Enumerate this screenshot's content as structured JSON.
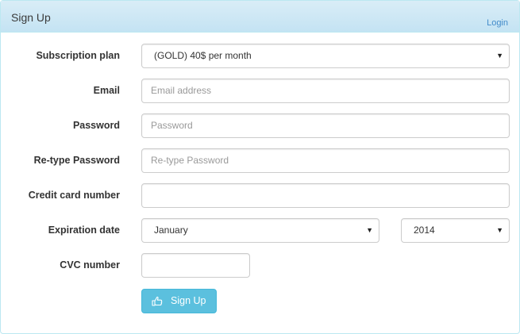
{
  "header": {
    "title": "Sign Up",
    "login_link": "Login"
  },
  "form": {
    "subscription_plan": {
      "label": "Subscription plan",
      "selected": "(GOLD) 40$ per month"
    },
    "email": {
      "label": "Email",
      "value": "",
      "placeholder": "Email address"
    },
    "password": {
      "label": "Password",
      "value": "",
      "placeholder": "Password"
    },
    "retype_password": {
      "label": "Re-type Password",
      "value": "",
      "placeholder": "Re-type Password"
    },
    "credit_card": {
      "label": "Credit card number",
      "value": ""
    },
    "expiration": {
      "label": "Expiration date",
      "month_selected": "January",
      "year_selected": "2014"
    },
    "cvc": {
      "label": "CVC number",
      "value": ""
    },
    "submit": {
      "label": "Sign Up",
      "icon": "hand-pointer-icon"
    }
  },
  "colors": {
    "header_bg": "#d9edf7",
    "border": "#bce8f1",
    "link": "#428bca",
    "button_bg": "#5bc0de",
    "button_text": "#ffffff",
    "placeholder": "#999999"
  }
}
